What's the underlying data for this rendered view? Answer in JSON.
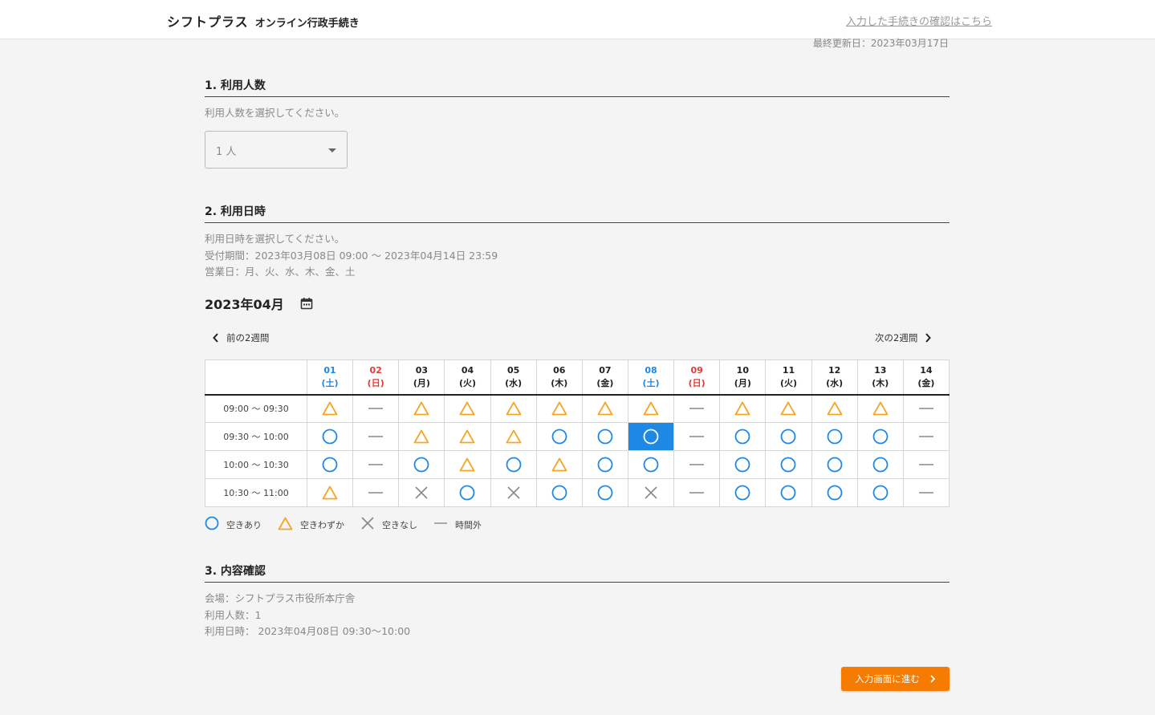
{
  "header": {
    "brand": "シフトプラス",
    "subtitle": "オンライン行政手続き",
    "confirm_link": "入力した手続きの確認はこちら"
  },
  "last_updated": "最終更新日：2023年03月17日",
  "section1": {
    "title": "1. 利用人数",
    "instruction": "利用人数を選択してください。",
    "selected_value": "1 人"
  },
  "section2": {
    "title": "2. 利用日時",
    "instruction": "利用日時を選択してください。",
    "period": "受付期間：2023年03月08日 09:00 〜 2023年04月14日 23:59",
    "business_days": "営業日：月、火、水、木、金、土"
  },
  "calendar": {
    "month": "2023年04月",
    "prev_label": "前の2週間",
    "next_label": "次の2週間",
    "days": [
      {
        "date": "01",
        "dow": "(土)",
        "type": "sat"
      },
      {
        "date": "02",
        "dow": "(日)",
        "type": "sun"
      },
      {
        "date": "03",
        "dow": "(月)",
        "type": ""
      },
      {
        "date": "04",
        "dow": "(火)",
        "type": ""
      },
      {
        "date": "05",
        "dow": "(水)",
        "type": ""
      },
      {
        "date": "06",
        "dow": "(木)",
        "type": ""
      },
      {
        "date": "07",
        "dow": "(金)",
        "type": ""
      },
      {
        "date": "08",
        "dow": "(土)",
        "type": "sat"
      },
      {
        "date": "09",
        "dow": "(日)",
        "type": "sun"
      },
      {
        "date": "10",
        "dow": "(月)",
        "type": ""
      },
      {
        "date": "11",
        "dow": "(火)",
        "type": ""
      },
      {
        "date": "12",
        "dow": "(水)",
        "type": ""
      },
      {
        "date": "13",
        "dow": "(木)",
        "type": ""
      },
      {
        "date": "14",
        "dow": "(金)",
        "type": ""
      }
    ],
    "rows": [
      {
        "time": "09:00 〜 09:30",
        "slots": [
          "few",
          "off",
          "few",
          "few",
          "few",
          "few",
          "few",
          "few",
          "off",
          "few",
          "few",
          "few",
          "few",
          "off"
        ]
      },
      {
        "time": "09:30 〜 10:00",
        "slots": [
          "available",
          "off",
          "few",
          "few",
          "few",
          "available",
          "available",
          "available",
          "off",
          "available",
          "available",
          "available",
          "available",
          "off"
        ]
      },
      {
        "time": "10:00 〜 10:30",
        "slots": [
          "available",
          "off",
          "available",
          "few",
          "available",
          "few",
          "available",
          "available",
          "off",
          "available",
          "available",
          "available",
          "available",
          "off"
        ]
      },
      {
        "time": "10:30 〜 11:00",
        "slots": [
          "few",
          "off",
          "full",
          "available",
          "full",
          "available",
          "available",
          "full",
          "off",
          "available",
          "available",
          "available",
          "available",
          "off"
        ]
      }
    ],
    "selected": {
      "row": 1,
      "col": 7
    }
  },
  "legend": {
    "available": "空きあり",
    "few": "空きわずか",
    "full": "空きなし",
    "off": "時間外"
  },
  "section3": {
    "title": "3. 内容確認",
    "venue": "会場：シフトプラス市役所本庁舎",
    "people": "利用人数：1",
    "datetime": "利用日時： 2023年04月08日 09:30〜10:00"
  },
  "next_button": "入力画面に進む",
  "colors": {
    "blue": "#1e88e5",
    "orange": "#f5a623",
    "red": "#e53935",
    "gray": "#888888",
    "button": "#f57c00"
  }
}
